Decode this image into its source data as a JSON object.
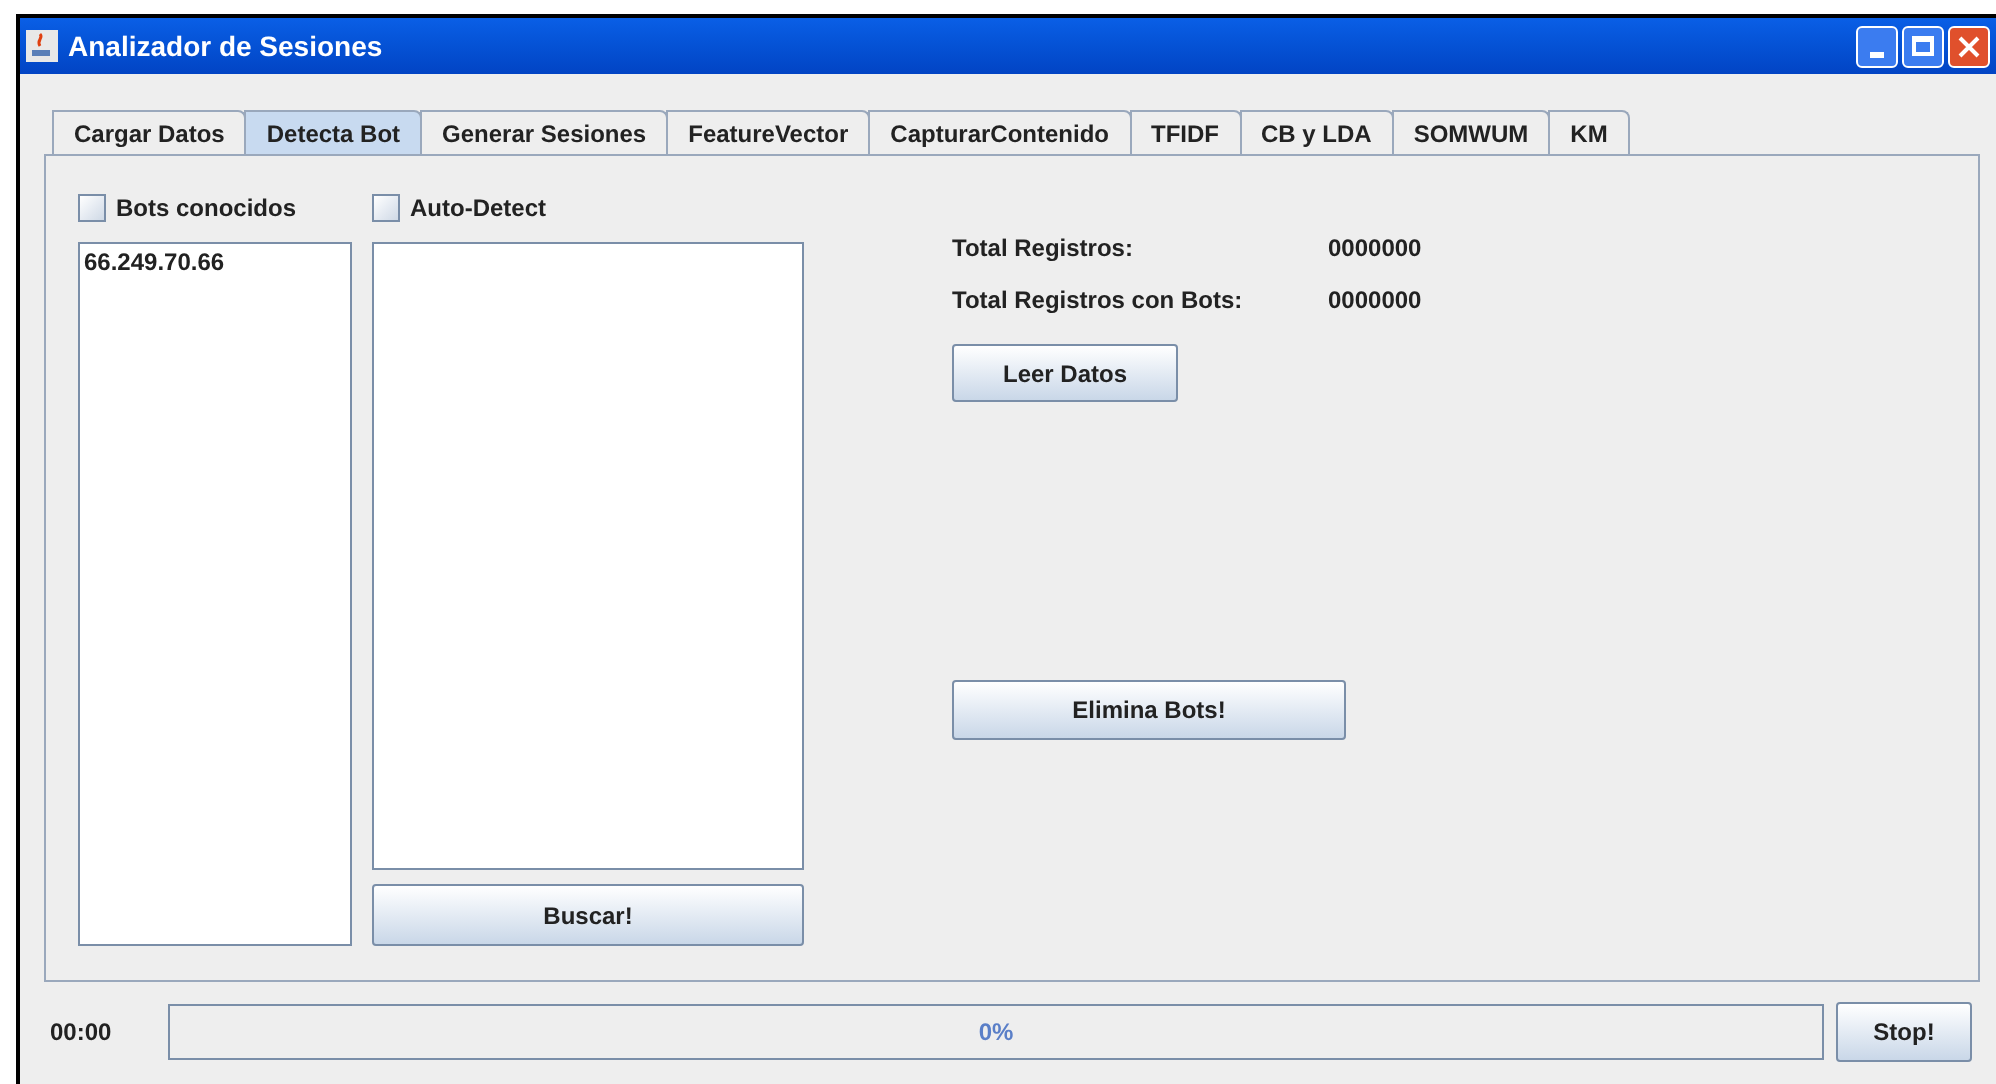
{
  "window": {
    "title": "Analizador de Sesiones"
  },
  "tabs": [
    {
      "label": "Cargar Datos",
      "selected": false
    },
    {
      "label": "Detecta Bot",
      "selected": true
    },
    {
      "label": "Generar Sesiones",
      "selected": false
    },
    {
      "label": "FeatureVector",
      "selected": false
    },
    {
      "label": "CapturarContenido",
      "selected": false
    },
    {
      "label": "TFIDF",
      "selected": false
    },
    {
      "label": "CB y LDA",
      "selected": false
    },
    {
      "label": "SOMWUM",
      "selected": false
    },
    {
      "label": "KM",
      "selected": false
    }
  ],
  "checkboxes": [
    {
      "label": "Bots conocidos",
      "checked": false
    },
    {
      "label": "Auto-Detect",
      "checked": false
    }
  ],
  "known_bots": [
    "66.249.70.66"
  ],
  "search_button": "Buscar!",
  "stats": [
    {
      "label": "Total Registros:",
      "value": "0000000"
    },
    {
      "label": "Total Registros con Bots:",
      "value": "0000000"
    }
  ],
  "read_button": "Leer Datos",
  "remove_button": "Elimina Bots!",
  "status": {
    "time": "00:00",
    "level": 0,
    "progress_text": "0%",
    "stop_button": "Stop!"
  }
}
